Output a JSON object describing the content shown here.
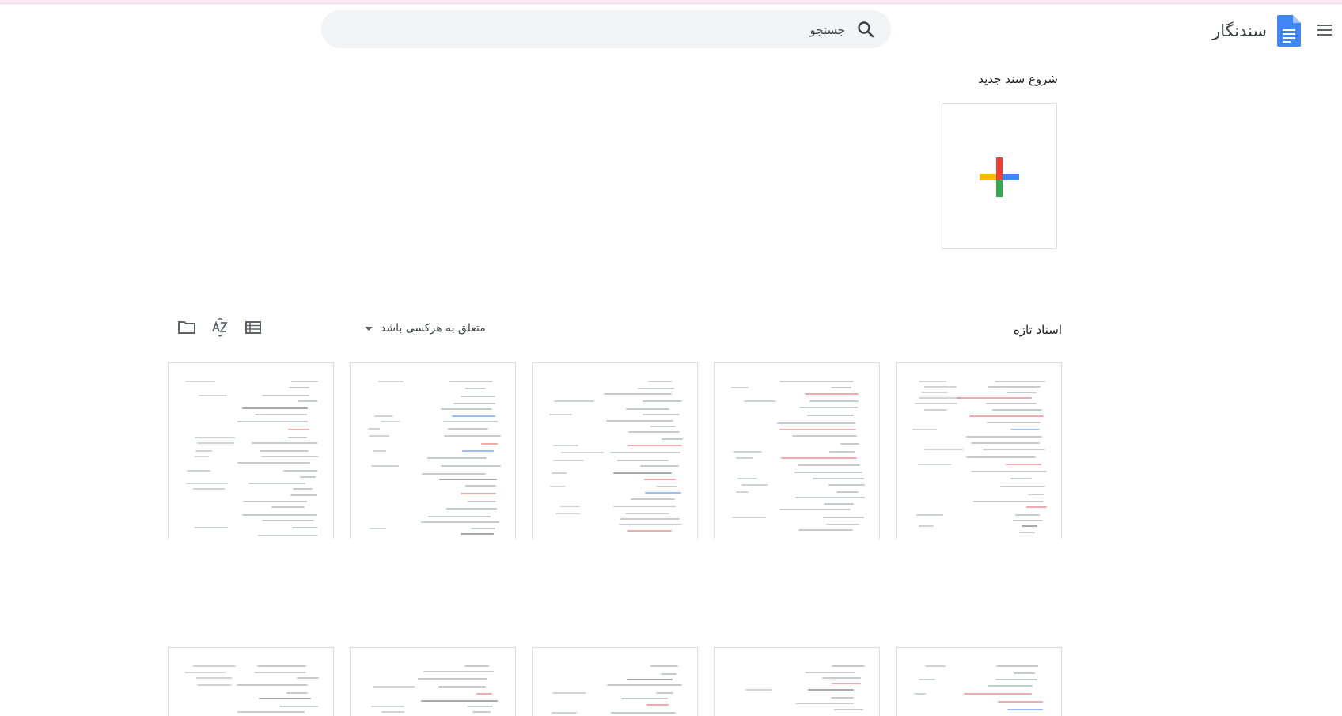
{
  "header": {
    "app_name": "سندنگار",
    "search": {
      "placeholder": "جستجو"
    }
  },
  "new_section": {
    "title": "شروع سند جدید"
  },
  "recent": {
    "title": "اسناد تازه",
    "owner_filter": "متعلق به هرکسی باشد"
  },
  "icons": {
    "menu": "menu-icon",
    "logo": "docs-logo-icon",
    "search": "search-icon",
    "plus": "plus-icon",
    "list_view": "list-view-icon",
    "sort": "sort-az-icon",
    "folder": "folder-icon",
    "caret": "caret-down-icon"
  },
  "colors": {
    "brand_blue": "#4285f4",
    "plus_red": "#ea4335",
    "plus_yellow": "#fbbc04",
    "plus_green": "#34a853",
    "search_bg": "#f1f3f4",
    "border": "#dadce0"
  },
  "documents": [
    {
      "row": 1,
      "index": 1
    },
    {
      "row": 1,
      "index": 2
    },
    {
      "row": 1,
      "index": 3
    },
    {
      "row": 1,
      "index": 4
    },
    {
      "row": 1,
      "index": 5
    },
    {
      "row": 2,
      "index": 1
    },
    {
      "row": 2,
      "index": 2
    },
    {
      "row": 2,
      "index": 3
    },
    {
      "row": 2,
      "index": 4
    },
    {
      "row": 2,
      "index": 5
    }
  ]
}
